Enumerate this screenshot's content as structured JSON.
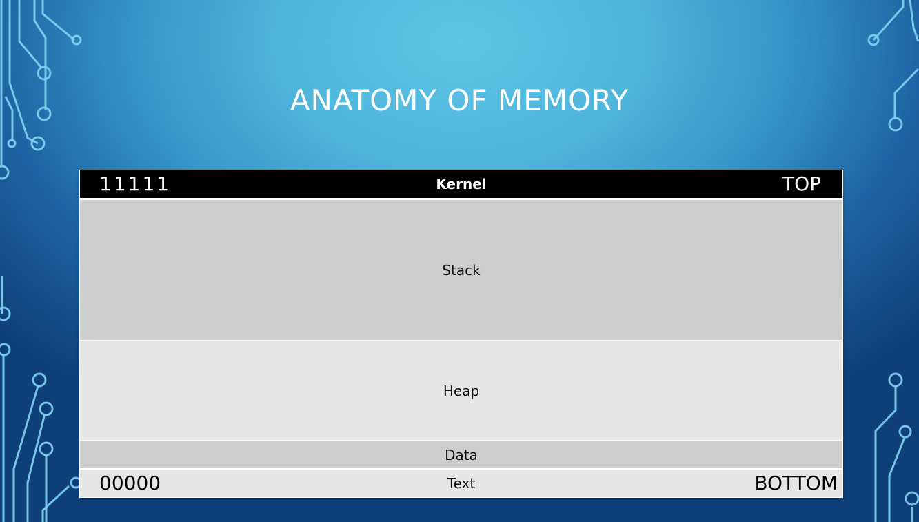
{
  "slide": {
    "title": "ANATOMY OF MEMORY"
  },
  "memory": {
    "top_address": "11111",
    "top_label": "TOP",
    "bottom_address": "00000",
    "bottom_label": "BOTTOM",
    "segments": [
      {
        "label": "Kernel"
      },
      {
        "label": "Stack"
      },
      {
        "label": "Heap"
      },
      {
        "label": "Data"
      },
      {
        "label": "Text"
      }
    ]
  },
  "colors": {
    "background_light": "#5cc5e6",
    "background_dark": "#0f3f7a",
    "circuit": "#7fd3f2",
    "kernel_fill": "#000000",
    "segment_dark": "#cdcdcd",
    "segment_light": "#e6e6e6"
  }
}
